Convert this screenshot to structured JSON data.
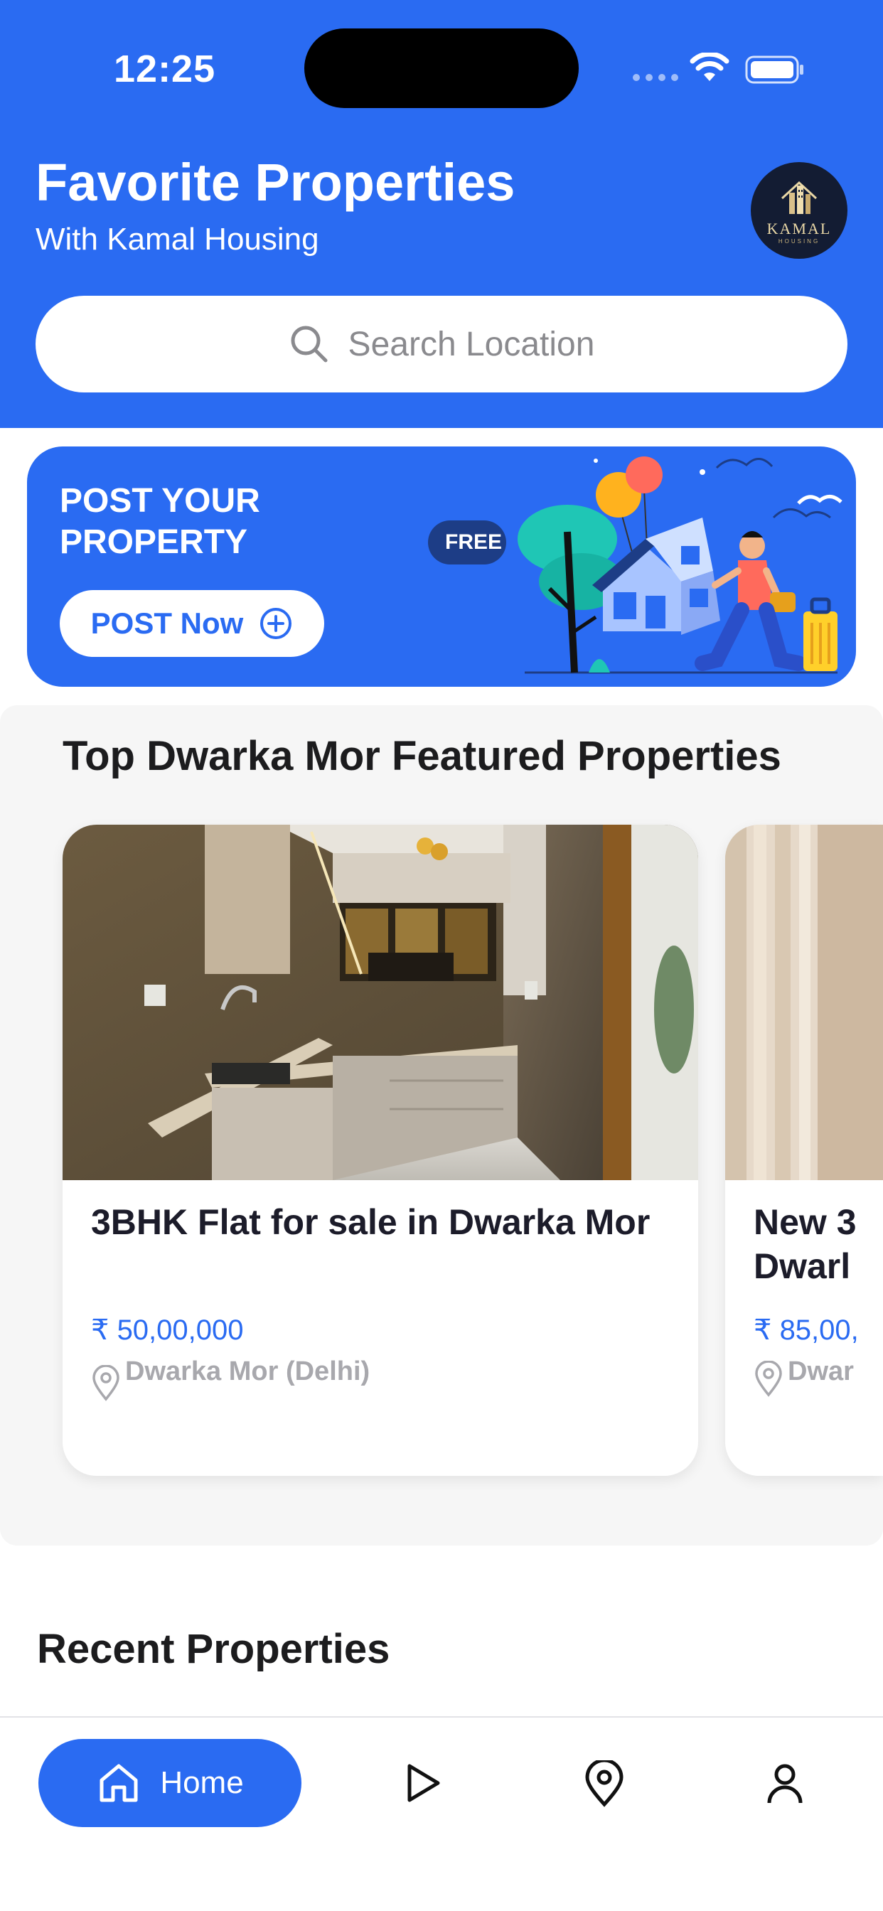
{
  "status_bar": {
    "time": "12:25"
  },
  "header": {
    "title": "Favorite Properties",
    "subtitle": "With Kamal Housing",
    "logo_text": "KAMAL",
    "logo_subtext": "HOUSING"
  },
  "search": {
    "placeholder": "Search Location",
    "icon": "search-icon"
  },
  "post_banner": {
    "title": "POST YOUR PROPERTY",
    "button_label": "POST Now",
    "button_icon": "plus-circle-icon",
    "badge": "FREE"
  },
  "featured": {
    "title": "Top Dwarka Mor Featured Properties",
    "cards": [
      {
        "title": "3BHK Flat for sale in Dwarka Mor",
        "price": "₹ 50,00,000",
        "location": "Dwarka Mor (Delhi)"
      },
      {
        "title": "New 3 Dwarl",
        "price": "₹ 85,00,",
        "location": "Dwar"
      }
    ]
  },
  "recent": {
    "title": "Recent Properties"
  },
  "tabbar": {
    "items": [
      {
        "label": "Home",
        "icon": "home-icon",
        "active": true
      },
      {
        "label": "",
        "icon": "play-icon",
        "active": false
      },
      {
        "label": "",
        "icon": "location-pin-icon",
        "active": false
      },
      {
        "label": "",
        "icon": "user-icon",
        "active": false
      }
    ]
  },
  "colors": {
    "primary": "#2a6bf2",
    "price": "#2a6bf2",
    "muted": "#a8a8ad"
  }
}
